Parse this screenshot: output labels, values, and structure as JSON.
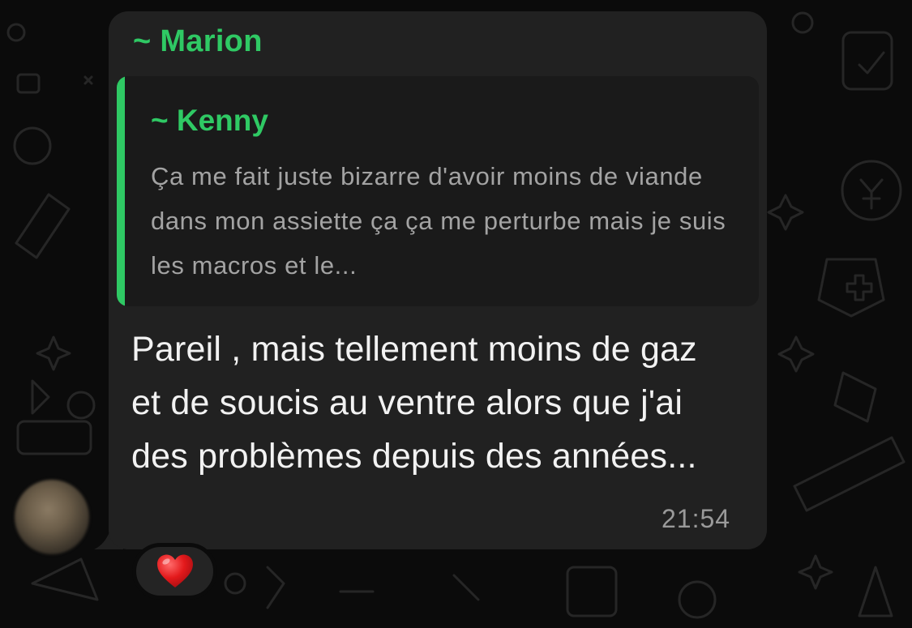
{
  "message": {
    "sender": "~ Marion",
    "quote": {
      "author": "~ Kenny",
      "text": "Ça me fait juste bizarre d'avoir moins de viande dans mon assiette ça ça me perturbe mais je suis les macros et le..."
    },
    "body": "Pareil , mais tellement moins de gaz et de soucis au ventre alors que j'ai des problèmes depuis des années...",
    "time": "21:54",
    "reaction": {
      "emoji": "❤️",
      "icon": "red-heart-icon"
    }
  },
  "colors": {
    "background": "#0b0b0b",
    "bubble": "#212121",
    "quote_background": "#1a1a1a",
    "accent_green": "#2fc964",
    "message_text": "#f2f2f2",
    "quote_text": "#a3a3a3",
    "timestamp": "#9a9a9a"
  }
}
